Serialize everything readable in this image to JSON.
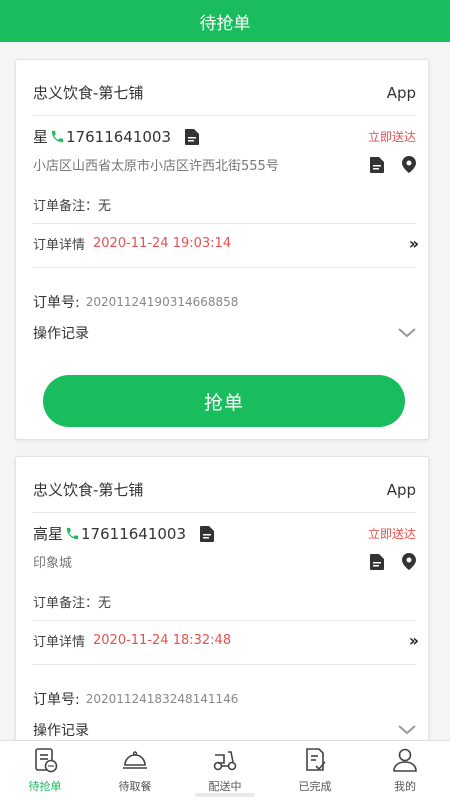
{
  "header": {
    "title": "待抢单"
  },
  "orders": [
    {
      "shop": "忠义饮食-第七铺",
      "source": "App",
      "customer": "星",
      "phone": "17611641003",
      "urgency": "立即送达",
      "address": "小店区山西省太原市小店区许西北街555号",
      "note": "订单备注：无",
      "detail_label": "订单详情",
      "detail_time": "2020-11-24 19:03:14",
      "order_label": "订单号:",
      "order_no": "20201124190314668858",
      "log_label": "操作记录",
      "grab_label": "抢单"
    },
    {
      "shop": "忠义饮食-第七铺",
      "source": "App",
      "customer": "高星",
      "phone": "17611641003",
      "urgency": "立即送达",
      "address": "印象城",
      "note": "订单备注：无",
      "detail_label": "订单详情",
      "detail_time": "2020-11-24 18:32:48",
      "order_label": "订单号:",
      "order_no": "20201124183248141146",
      "log_label": "操作记录"
    }
  ],
  "tabs": [
    {
      "label": "待抢单",
      "icon": "pending-orders-icon"
    },
    {
      "label": "待取餐",
      "icon": "food-cloche-icon"
    },
    {
      "label": "配送中",
      "icon": "scooter-icon"
    },
    {
      "label": "已完成",
      "icon": "completed-doc-icon"
    },
    {
      "label": "我的",
      "icon": "user-icon"
    }
  ],
  "colors": {
    "accent": "#19bd5d",
    "urgent": "#e85050"
  }
}
